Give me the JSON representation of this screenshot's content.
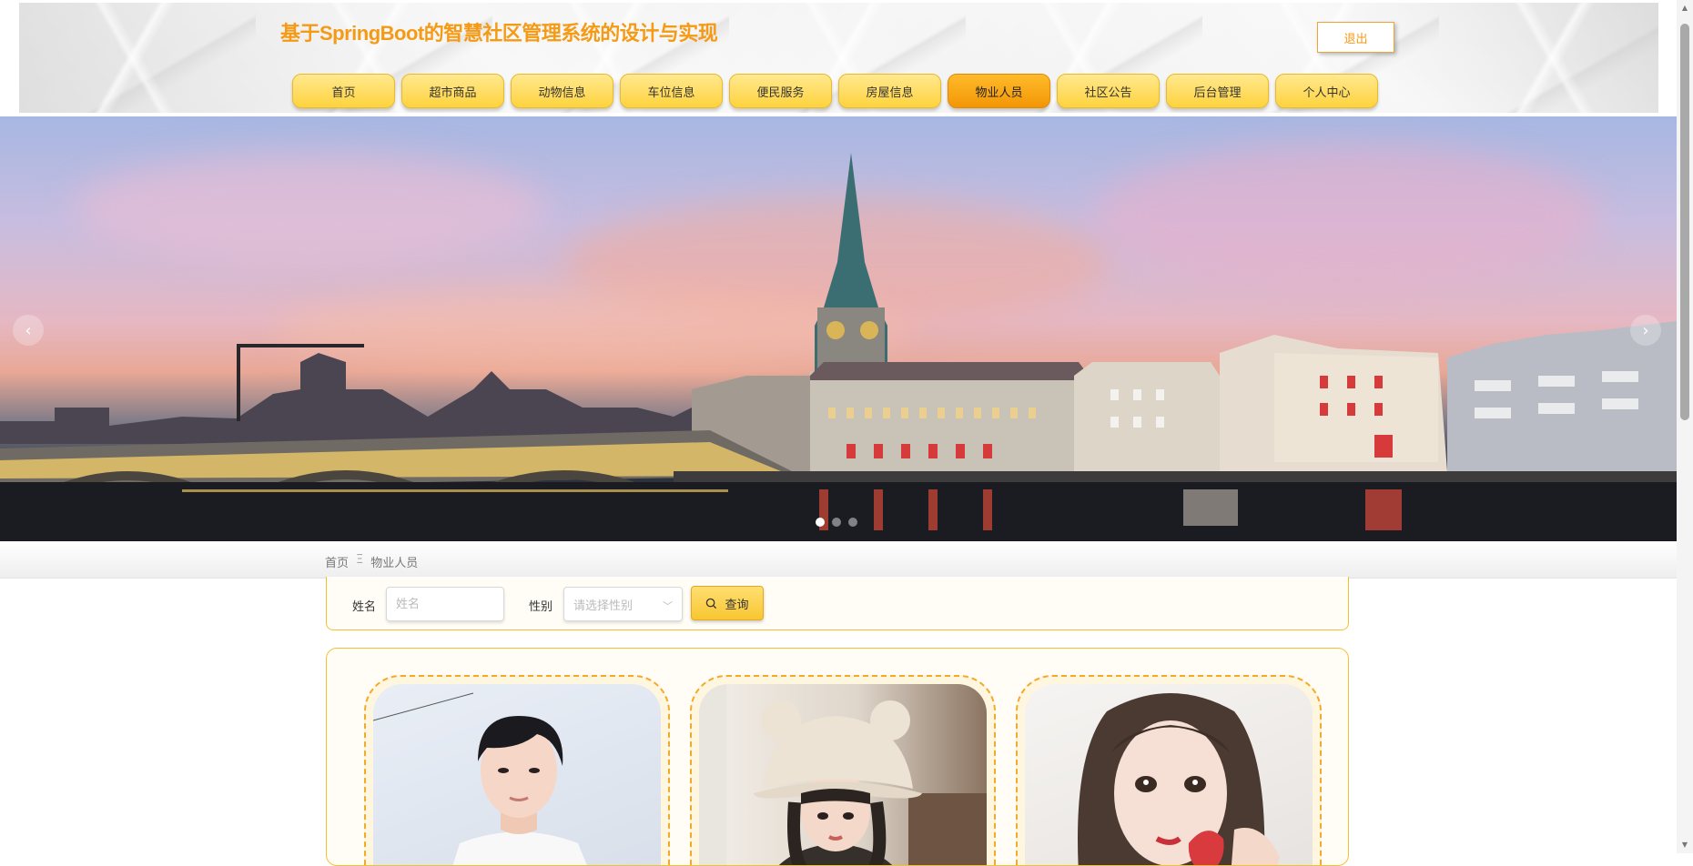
{
  "site": {
    "title": "基于SpringBoot的智慧社区管理系统的设计与实现",
    "logout_label": "退出"
  },
  "nav": {
    "items": [
      {
        "label": "首页"
      },
      {
        "label": "超市商品"
      },
      {
        "label": "动物信息"
      },
      {
        "label": "车位信息"
      },
      {
        "label": "便民服务"
      },
      {
        "label": "房屋信息"
      },
      {
        "label": "物业人员",
        "active": true
      },
      {
        "label": "社区公告"
      },
      {
        "label": "后台管理"
      },
      {
        "label": "个人中心"
      }
    ]
  },
  "banner": {
    "prev_icon": "chevron-left-icon",
    "next_icon": "chevron-right-icon",
    "prev_glyph": "‹",
    "next_glyph": "›",
    "slide_count": 3,
    "active_slide": 1
  },
  "breadcrumb": {
    "home": "首页",
    "separator": "Ξ",
    "current": "物业人员"
  },
  "search": {
    "name_label": "姓名",
    "name_placeholder": "姓名",
    "gender_label": "性别",
    "gender_placeholder": "请选择性别",
    "query_label": "查询",
    "query_icon": "search-icon"
  },
  "colors": {
    "accent": "#f59a14",
    "nav_bg": "#ffd33e",
    "nav_active": "#f39606",
    "border": "#f3c034"
  }
}
